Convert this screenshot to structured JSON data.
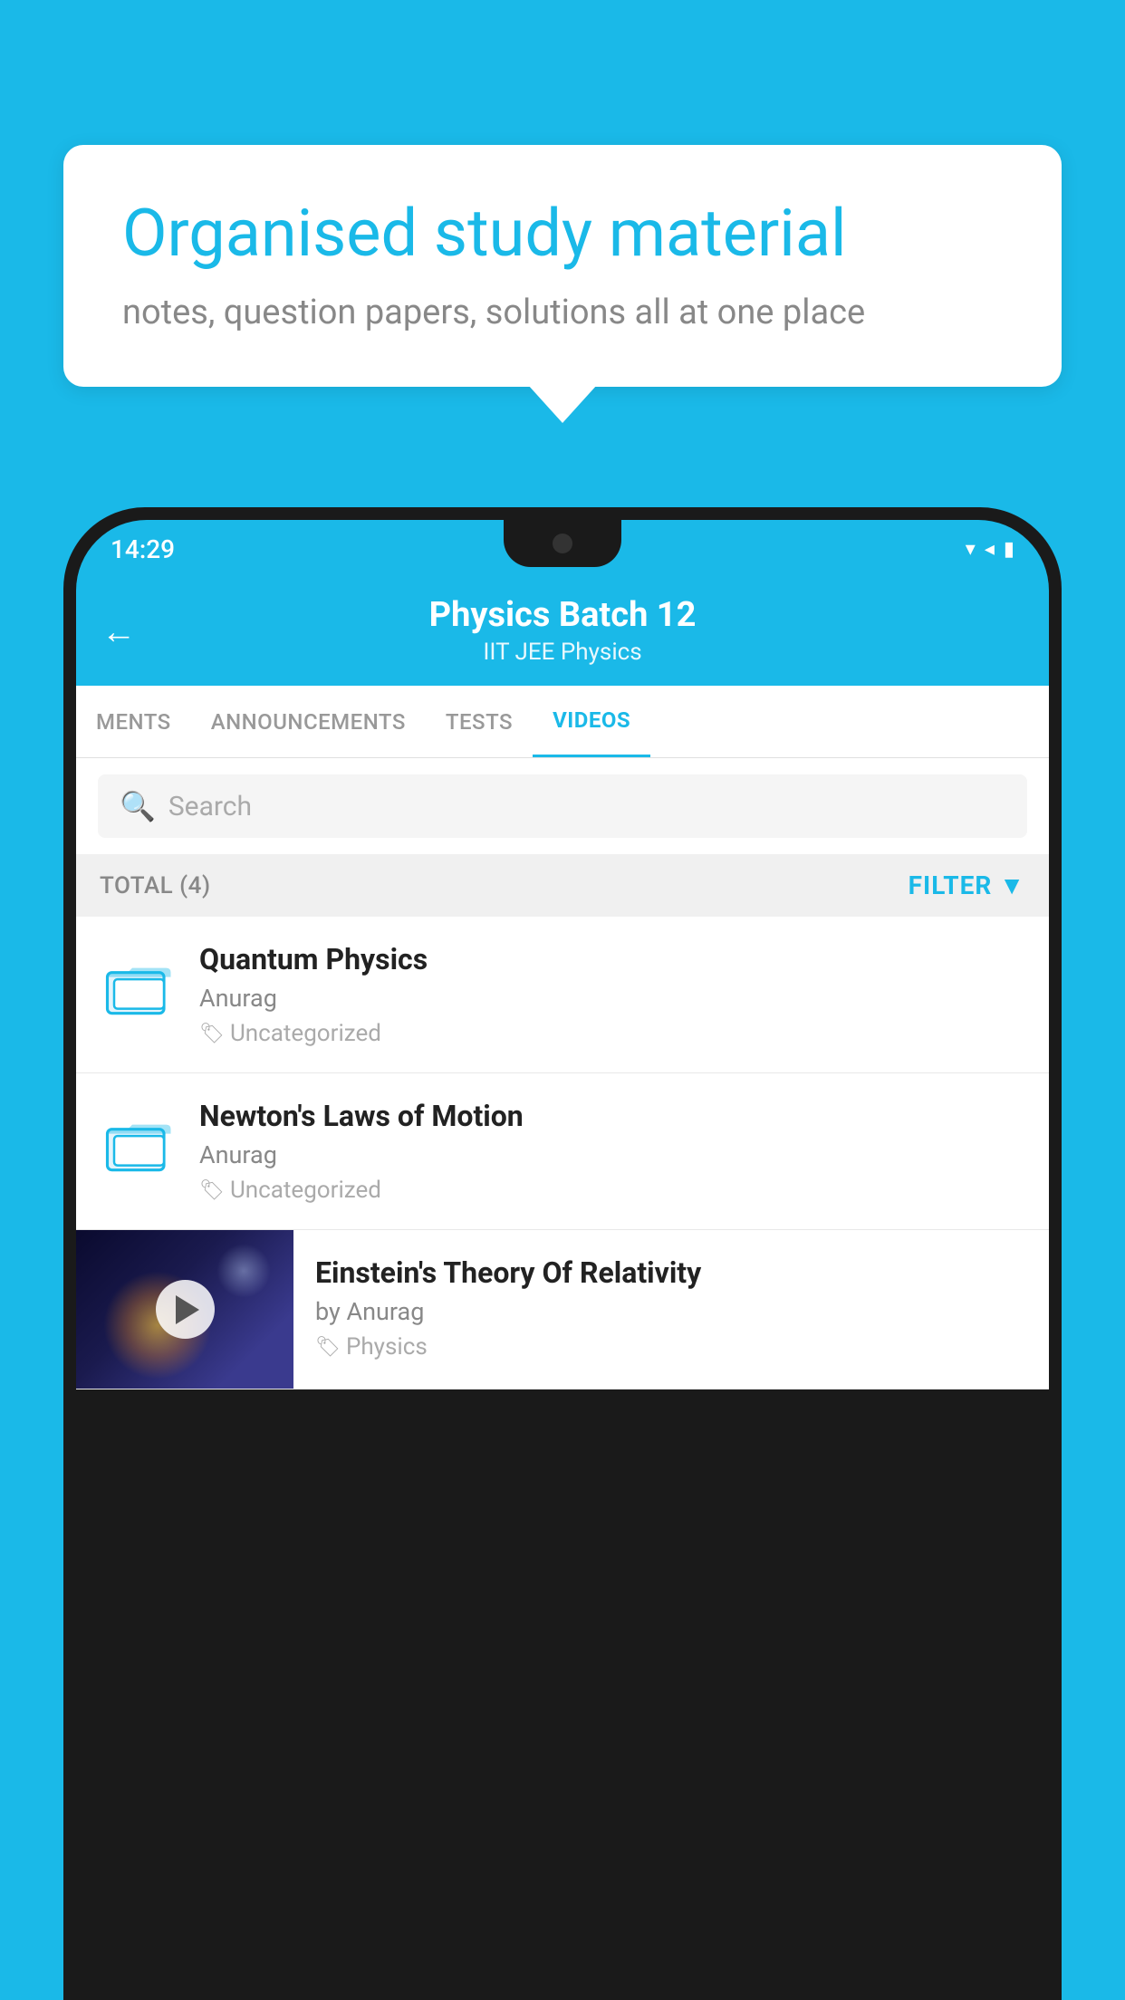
{
  "background_color": "#1ab9e8",
  "speech_bubble": {
    "title": "Organised study material",
    "subtitle": "notes, question papers, solutions all at one place"
  },
  "status_bar": {
    "time": "14:29",
    "icons": "▾◂▮"
  },
  "app_header": {
    "title": "Physics Batch 12",
    "subtitle": "IIT JEE   Physics",
    "back_label": "←"
  },
  "tabs": [
    {
      "label": "MENTS",
      "active": false
    },
    {
      "label": "ANNOUNCEMENTS",
      "active": false
    },
    {
      "label": "TESTS",
      "active": false
    },
    {
      "label": "VIDEOS",
      "active": true
    }
  ],
  "search": {
    "placeholder": "Search"
  },
  "filter_bar": {
    "total_label": "TOTAL (4)",
    "filter_label": "FILTER"
  },
  "videos": [
    {
      "title": "Quantum Physics",
      "author": "Anurag",
      "tag": "Uncategorized",
      "has_thumbnail": false
    },
    {
      "title": "Newton's Laws of Motion",
      "author": "Anurag",
      "tag": "Uncategorized",
      "has_thumbnail": false
    },
    {
      "title": "Einstein's Theory Of Relativity",
      "author": "by Anurag",
      "tag": "Physics",
      "has_thumbnail": true
    }
  ],
  "colors": {
    "accent": "#1ab9e8",
    "text_dark": "#222222",
    "text_grey": "#888888",
    "text_light": "#aaaaaa"
  }
}
